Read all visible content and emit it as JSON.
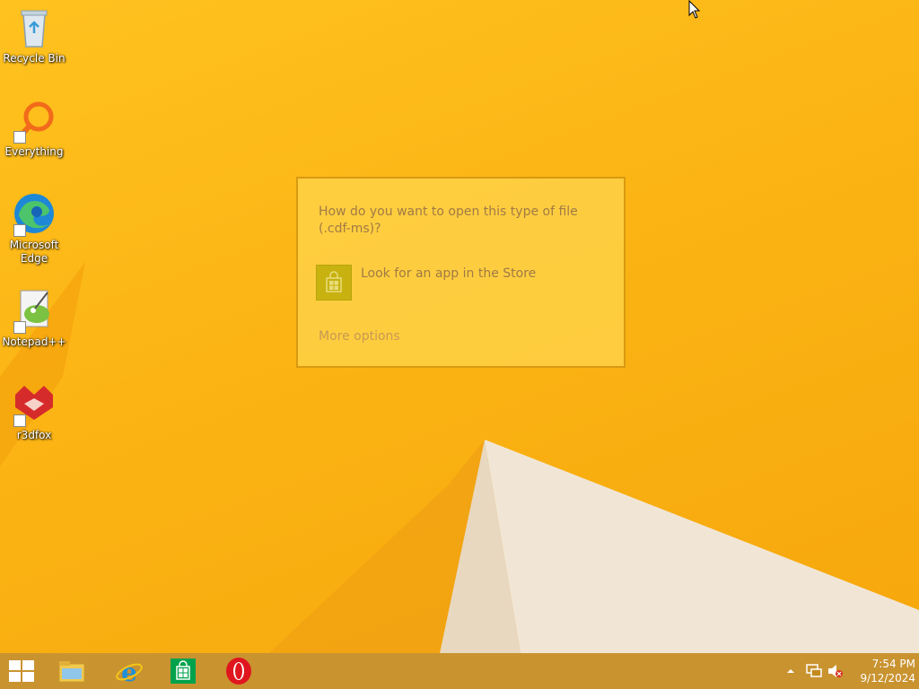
{
  "desktop_icons": [
    {
      "name": "recycle-bin",
      "label": "Recycle Bin"
    },
    {
      "name": "everything",
      "label": "Everything"
    },
    {
      "name": "microsoft-edge",
      "label": "Microsoft Edge"
    },
    {
      "name": "notepad-plus-plus",
      "label": "Notepad++"
    },
    {
      "name": "r3dfox",
      "label": "r3dfox"
    }
  ],
  "dialog": {
    "title": "How do you want to open this type of file (.cdf-ms)?",
    "store_option": "Look for an app in the Store",
    "more_options": "More options"
  },
  "taskbar": {
    "pinned": [
      "start-icon",
      "file-explorer-icon",
      "internet-explorer-icon",
      "store-icon",
      "opera-icon"
    ],
    "tray_icons": [
      "show-hidden-icons-chevron",
      "network-icon",
      "volume-muted-icon"
    ],
    "time": "7:54 PM",
    "date": "9/12/2024"
  },
  "colors": {
    "wallpaper_base": "#fbb414",
    "dialog_bg": "#ffd34a",
    "dialog_text": "#a07a45",
    "store_tile": "#c8b210"
  }
}
